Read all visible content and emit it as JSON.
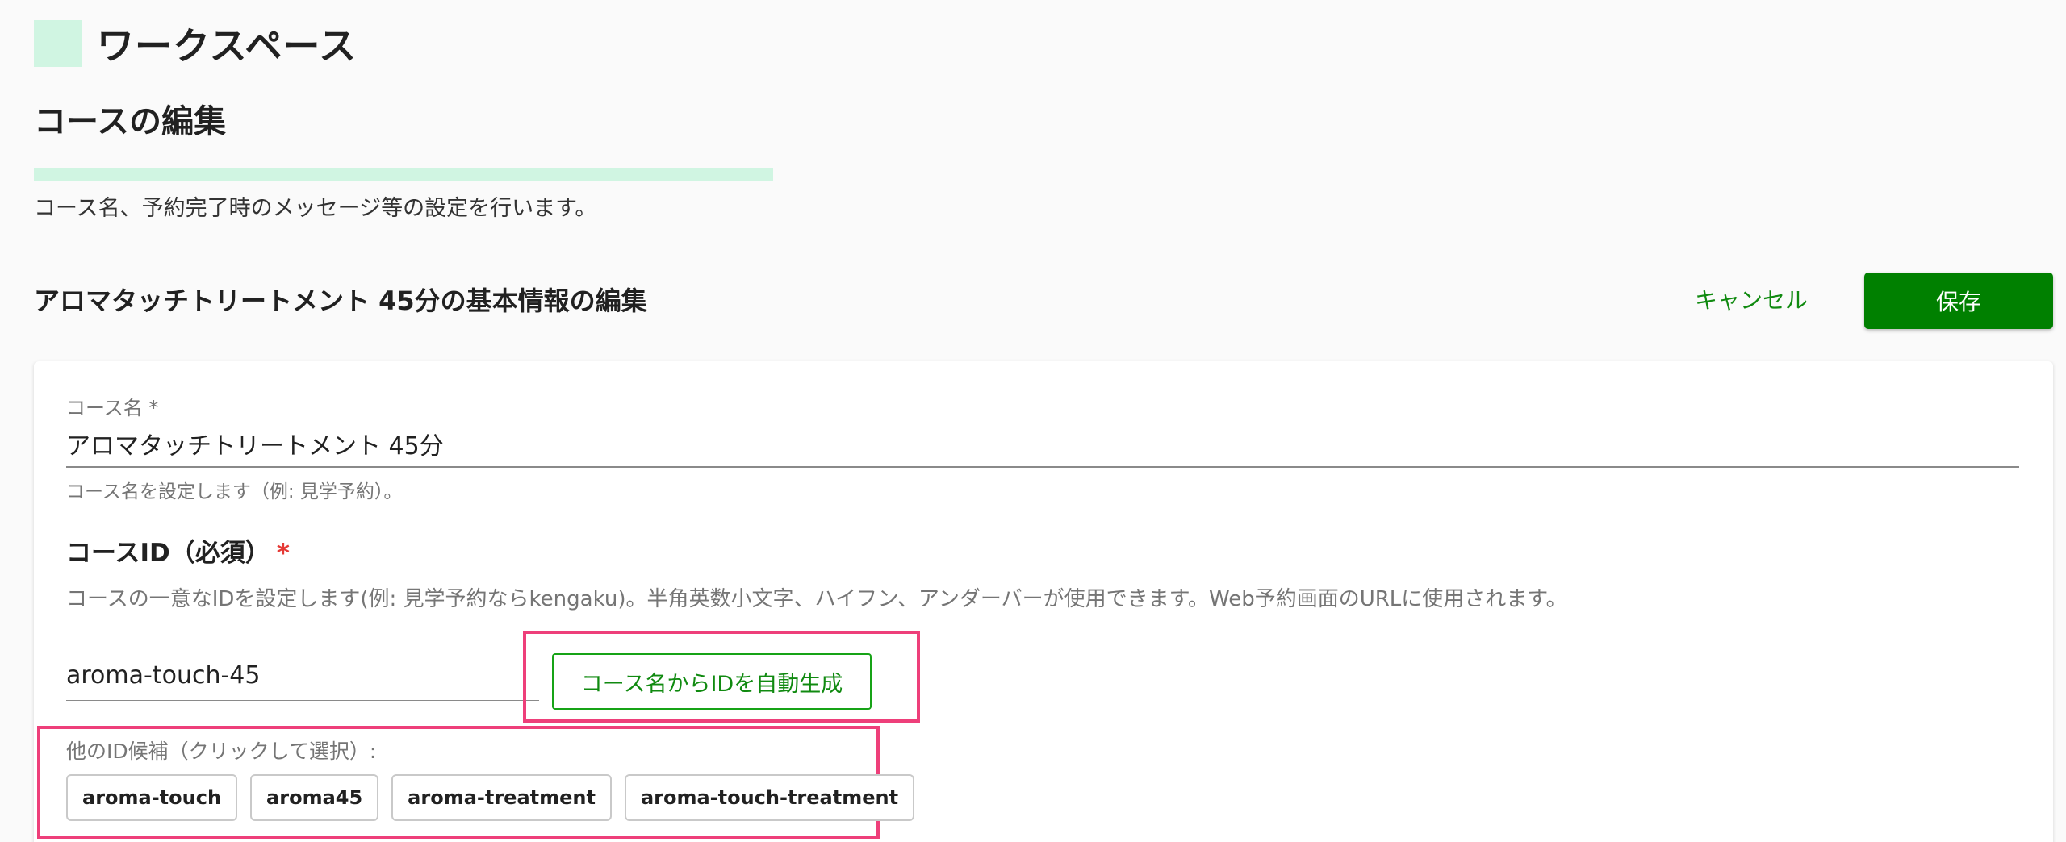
{
  "workspace": {
    "title": "ワークスペース",
    "logo_color": "#d0f5e2"
  },
  "page": {
    "title": "コースの編集",
    "description": "コース名、予約完了時のメッセージ等の設定を行います。",
    "progress_percent": 100
  },
  "section": {
    "title": "アロマタッチトリートメント 45分の基本情報の編集",
    "cancel_label": "キャンセル",
    "save_label": "保存"
  },
  "course_name": {
    "label": "コース名 *",
    "value": "アロマタッチトリートメント 45分",
    "helper": "コース名を設定します（例: 見学予約）。"
  },
  "course_id": {
    "heading": "コースID（必須）",
    "required_mark": "*",
    "description": "コースの一意なIDを設定します(例: 見学予約ならkengaku)。半角英数小文字、ハイフン、アンダーバーが使用できます。Web予約画面のURLに使用されます。",
    "value": "aroma-touch-45",
    "autogen_label": "コース名からIDを自動生成",
    "candidates_label": "他のID候補（クリックして選択）:",
    "candidates": [
      "aroma-touch",
      "aroma45",
      "aroma-treatment",
      "aroma-touch-treatment"
    ]
  },
  "colors": {
    "accent_green": "#008000",
    "link_green": "#108a10",
    "highlight_pink": "#ee3f7a",
    "required_red": "#e53935"
  }
}
